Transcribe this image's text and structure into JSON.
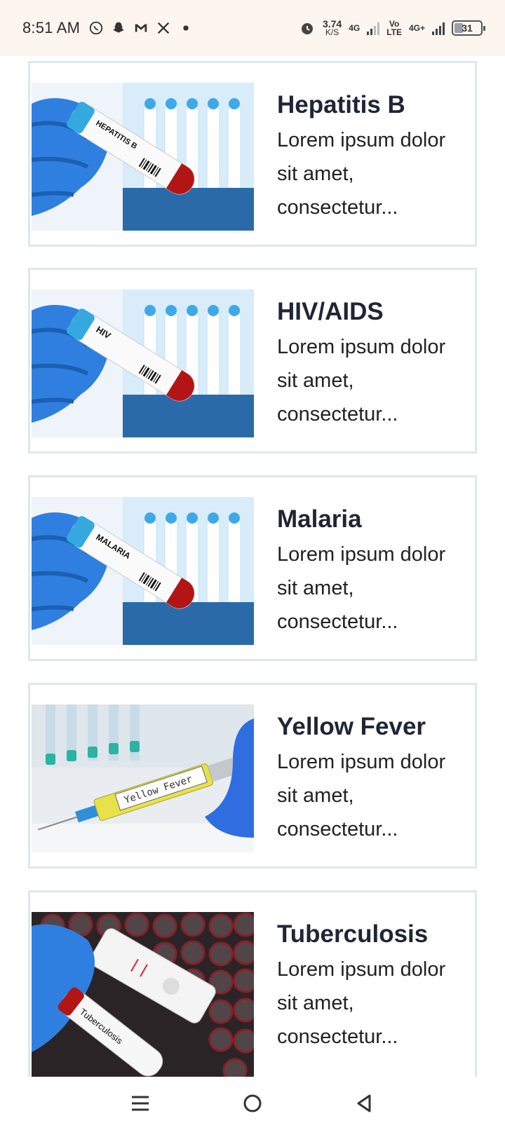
{
  "status_bar": {
    "time": "8:51 AM",
    "net_speed_value": "3.74",
    "net_speed_unit": "K/S",
    "net_type_1": "4G",
    "volte_top": "Vo",
    "volte_bottom": "LTE",
    "net_type_2": "4G+",
    "battery_level": "31",
    "notification_icons": [
      "whatsapp-icon",
      "snapchat-icon",
      "gmail-icon",
      "x-icon",
      "dot-icon"
    ]
  },
  "cards": [
    {
      "title": "Hepatitis B",
      "desc": "Lorem ipsum dolor sit amet, consectetur...",
      "image": "hepatitis-b-test-tube",
      "tube_label": "HEPATITIS B"
    },
    {
      "title": "HIV/AIDS",
      "desc": "Lorem ipsum dolor sit amet, consectetur...",
      "image": "hiv-test-tube",
      "tube_label": "HIV"
    },
    {
      "title": "Malaria",
      "desc": "Lorem ipsum dolor sit amet, consectetur...",
      "image": "malaria-test-tube",
      "tube_label": "MALARIA"
    },
    {
      "title": "Yellow Fever",
      "desc": "Lorem ipsum dolor sit amet, consectetur...",
      "image": "yellow-fever-syringe",
      "tube_label": "Yellow Fever"
    },
    {
      "title": "Tuberculosis",
      "desc": "Lorem ipsum dolor sit amet, consectetur...",
      "image": "tuberculosis-test",
      "tube_label": "Tuberculosis"
    }
  ],
  "nav": {
    "items": [
      "menu-icon",
      "home-icon",
      "back-icon"
    ]
  },
  "colors": {
    "status_bg": "#fdf5f0",
    "card_border": "#dfe6ee",
    "glove_blue": "#2f7fe0",
    "rack_blue": "#3fa9e8"
  }
}
